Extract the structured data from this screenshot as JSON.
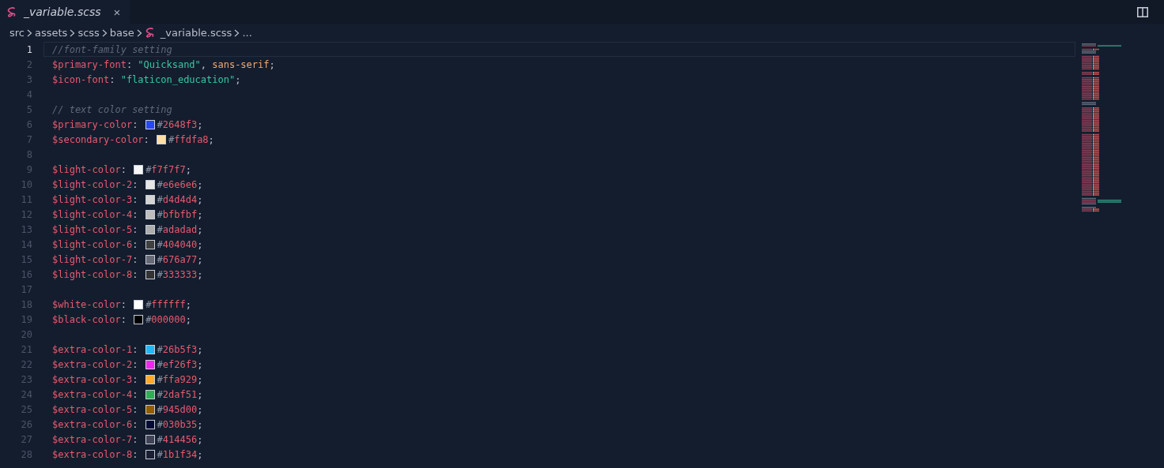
{
  "tab": {
    "label": "_variable.scss",
    "selected": true,
    "close": "×"
  },
  "breadcrumb": [
    "src",
    "assets",
    "scss",
    "base",
    "_variable.scss",
    "..."
  ],
  "lines": [
    {
      "number": "1",
      "selected": true,
      "tokens": [
        {
          "kind": "comment",
          "text": "//font-family setting"
        }
      ]
    },
    {
      "number": "2",
      "selected": false,
      "tokens": [
        {
          "kind": "variable",
          "text": "$primary-font"
        },
        {
          "kind": "punct",
          "text": ":"
        },
        {
          "kind": "string",
          "text": "\"Quicksand\""
        },
        {
          "kind": "punct",
          "text": ","
        },
        {
          "kind": "keyword",
          "text": "sans-serif"
        },
        {
          "kind": "punct",
          "text": ";"
        }
      ]
    },
    {
      "number": "3",
      "selected": false,
      "tokens": [
        {
          "kind": "variable",
          "text": "$icon-font"
        },
        {
          "kind": "punct",
          "text": ":"
        },
        {
          "kind": "string",
          "text": "\"flaticon_education\""
        },
        {
          "kind": "punct",
          "text": ";"
        }
      ]
    },
    {
      "number": "4",
      "selected": false
    },
    {
      "number": "5",
      "selected": false,
      "tokens": [
        {
          "kind": "comment",
          "text": "// text color setting"
        }
      ]
    },
    {
      "number": "6",
      "selected": false,
      "tokens": [
        {
          "kind": "variable",
          "text": "$primary-color"
        },
        {
          "kind": "punct",
          "text": ":"
        },
        {
          "kind": "swatch",
          "color": "#2648f3"
        },
        {
          "kind": "hex",
          "text": "#2648f3"
        },
        {
          "kind": "punct",
          "text": ";"
        }
      ]
    },
    {
      "number": "7",
      "selected": false,
      "tokens": [
        {
          "kind": "variable",
          "text": "$secondary-color"
        },
        {
          "kind": "punct",
          "text": ":"
        },
        {
          "kind": "swatch",
          "color": "#ffdfa8"
        },
        {
          "kind": "hex",
          "text": "#ffdfa8"
        },
        {
          "kind": "punct",
          "text": ";"
        }
      ]
    },
    {
      "number": "8",
      "selected": false
    },
    {
      "number": "9",
      "selected": false,
      "tokens": [
        {
          "kind": "variable",
          "text": "$light-color"
        },
        {
          "kind": "punct",
          "text": ":"
        },
        {
          "kind": "swatch",
          "color": "#f7f7f7"
        },
        {
          "kind": "hex",
          "text": "#f7f7f7"
        },
        {
          "kind": "punct",
          "text": ";"
        }
      ]
    },
    {
      "number": "10",
      "selected": false,
      "tokens": [
        {
          "kind": "variable",
          "text": "$light-color-2"
        },
        {
          "kind": "punct",
          "text": ":"
        },
        {
          "kind": "swatch",
          "color": "#e6e6e6"
        },
        {
          "kind": "hex",
          "text": "#e6e6e6"
        },
        {
          "kind": "punct",
          "text": ";"
        }
      ]
    },
    {
      "number": "11",
      "selected": false,
      "tokens": [
        {
          "kind": "variable",
          "text": "$light-color-3"
        },
        {
          "kind": "punct",
          "text": ":"
        },
        {
          "kind": "swatch",
          "color": "#d4d4d4"
        },
        {
          "kind": "hex",
          "text": "#d4d4d4"
        },
        {
          "kind": "punct",
          "text": ";"
        }
      ]
    },
    {
      "number": "12",
      "selected": false,
      "tokens": [
        {
          "kind": "variable",
          "text": "$light-color-4"
        },
        {
          "kind": "punct",
          "text": ":"
        },
        {
          "kind": "swatch",
          "color": "#bfbfbf"
        },
        {
          "kind": "hex",
          "text": "#bfbfbf"
        },
        {
          "kind": "punct",
          "text": ";"
        }
      ]
    },
    {
      "number": "13",
      "selected": false,
      "tokens": [
        {
          "kind": "variable",
          "text": "$light-color-5"
        },
        {
          "kind": "punct",
          "text": ":"
        },
        {
          "kind": "swatch",
          "color": "#adadad"
        },
        {
          "kind": "hex",
          "text": "#adadad"
        },
        {
          "kind": "punct",
          "text": ";"
        }
      ]
    },
    {
      "number": "14",
      "selected": false,
      "tokens": [
        {
          "kind": "variable",
          "text": "$light-color-6"
        },
        {
          "kind": "punct",
          "text": ":"
        },
        {
          "kind": "swatch",
          "color": "#404040"
        },
        {
          "kind": "hex",
          "text": "#404040"
        },
        {
          "kind": "punct",
          "text": ";"
        }
      ]
    },
    {
      "number": "15",
      "selected": false,
      "tokens": [
        {
          "kind": "variable",
          "text": "$light-color-7"
        },
        {
          "kind": "punct",
          "text": ":"
        },
        {
          "kind": "swatch",
          "color": "#676a77"
        },
        {
          "kind": "hex",
          "text": "#676a77"
        },
        {
          "kind": "punct",
          "text": ";"
        }
      ]
    },
    {
      "number": "16",
      "selected": false,
      "tokens": [
        {
          "kind": "variable",
          "text": "$light-color-8"
        },
        {
          "kind": "punct",
          "text": ":"
        },
        {
          "kind": "swatch",
          "color": "#333333"
        },
        {
          "kind": "hex",
          "text": "#333333"
        },
        {
          "kind": "punct",
          "text": ";"
        }
      ]
    },
    {
      "number": "17",
      "selected": false
    },
    {
      "number": "18",
      "selected": false,
      "tokens": [
        {
          "kind": "variable",
          "text": "$white-color"
        },
        {
          "kind": "punct",
          "text": ":"
        },
        {
          "kind": "swatch",
          "color": "#ffffff"
        },
        {
          "kind": "hex",
          "text": "#ffffff"
        },
        {
          "kind": "punct",
          "text": ";"
        }
      ]
    },
    {
      "number": "19",
      "selected": false,
      "tokens": [
        {
          "kind": "variable",
          "text": "$black-color"
        },
        {
          "kind": "punct",
          "text": ":"
        },
        {
          "kind": "swatch",
          "color": "#000000"
        },
        {
          "kind": "hex",
          "text": "#000000"
        },
        {
          "kind": "punct",
          "text": ";"
        }
      ]
    },
    {
      "number": "20",
      "selected": false
    },
    {
      "number": "21",
      "selected": false,
      "tokens": [
        {
          "kind": "variable",
          "text": "$extra-color-1"
        },
        {
          "kind": "punct",
          "text": ":"
        },
        {
          "kind": "swatch",
          "color": "#26b5f3"
        },
        {
          "kind": "hex",
          "text": "#26b5f3"
        },
        {
          "kind": "punct",
          "text": ";"
        }
      ]
    },
    {
      "number": "22",
      "selected": false,
      "tokens": [
        {
          "kind": "variable",
          "text": "$extra-color-2"
        },
        {
          "kind": "punct",
          "text": ":"
        },
        {
          "kind": "swatch",
          "color": "#ef26f3"
        },
        {
          "kind": "hex",
          "text": "#ef26f3"
        },
        {
          "kind": "punct",
          "text": ";"
        }
      ]
    },
    {
      "number": "23",
      "selected": false,
      "tokens": [
        {
          "kind": "variable",
          "text": "$extra-color-3"
        },
        {
          "kind": "punct",
          "text": ":"
        },
        {
          "kind": "swatch",
          "color": "#ffa929"
        },
        {
          "kind": "hex",
          "text": "#ffa929"
        },
        {
          "kind": "punct",
          "text": ";"
        }
      ]
    },
    {
      "number": "24",
      "selected": false,
      "tokens": [
        {
          "kind": "variable",
          "text": "$extra-color-4"
        },
        {
          "kind": "punct",
          "text": ":"
        },
        {
          "kind": "swatch",
          "color": "#2daf51"
        },
        {
          "kind": "hex",
          "text": "#2daf51"
        },
        {
          "kind": "punct",
          "text": ";"
        }
      ]
    },
    {
      "number": "25",
      "selected": false,
      "tokens": [
        {
          "kind": "variable",
          "text": "$extra-color-5"
        },
        {
          "kind": "punct",
          "text": ":"
        },
        {
          "kind": "swatch",
          "color": "#945d00"
        },
        {
          "kind": "hex",
          "text": "#945d00"
        },
        {
          "kind": "punct",
          "text": ";"
        }
      ]
    },
    {
      "number": "26",
      "selected": false,
      "tokens": [
        {
          "kind": "variable",
          "text": "$extra-color-6"
        },
        {
          "kind": "punct",
          "text": ":"
        },
        {
          "kind": "swatch",
          "color": "#030b35"
        },
        {
          "kind": "hex",
          "text": "#030b35"
        },
        {
          "kind": "punct",
          "text": ";"
        }
      ]
    },
    {
      "number": "27",
      "selected": false,
      "tokens": [
        {
          "kind": "variable",
          "text": "$extra-color-7"
        },
        {
          "kind": "punct",
          "text": ":"
        },
        {
          "kind": "swatch",
          "color": "#414456"
        },
        {
          "kind": "hex",
          "text": "#414456"
        },
        {
          "kind": "punct",
          "text": ";"
        }
      ]
    },
    {
      "number": "28",
      "selected": false,
      "tokens": [
        {
          "kind": "variable",
          "text": "$extra-color-8"
        },
        {
          "kind": "punct",
          "text": ":"
        },
        {
          "kind": "swatch",
          "color": "#1b1f34"
        },
        {
          "kind": "hex",
          "text": "#1b1f34"
        },
        {
          "kind": "punct",
          "text": ";"
        }
      ]
    }
  ]
}
